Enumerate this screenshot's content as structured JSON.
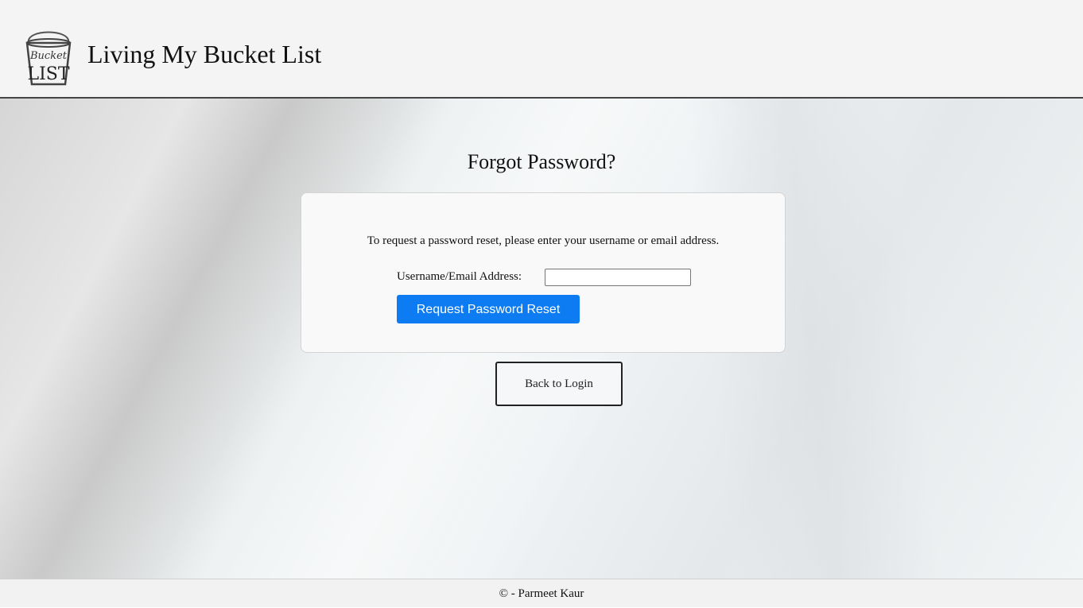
{
  "header": {
    "logo_icon": "bucket-list-logo-icon",
    "logo_text": [
      "Bucket",
      "LIST"
    ],
    "site_title": "Living My Bucket List"
  },
  "main": {
    "heading": "Forgot Password?",
    "form": {
      "instructions": "To request a password reset, please enter your username or email address.",
      "field_label": "Username/Email Address:",
      "field_value": "",
      "submit_label": "Request Password Reset"
    },
    "back_label": "Back to Login"
  },
  "footer": {
    "copyright": "© - Parmeet Kaur"
  },
  "colors": {
    "primary_button": "#0d7cf2",
    "header_bg": "#f4f4f4"
  }
}
